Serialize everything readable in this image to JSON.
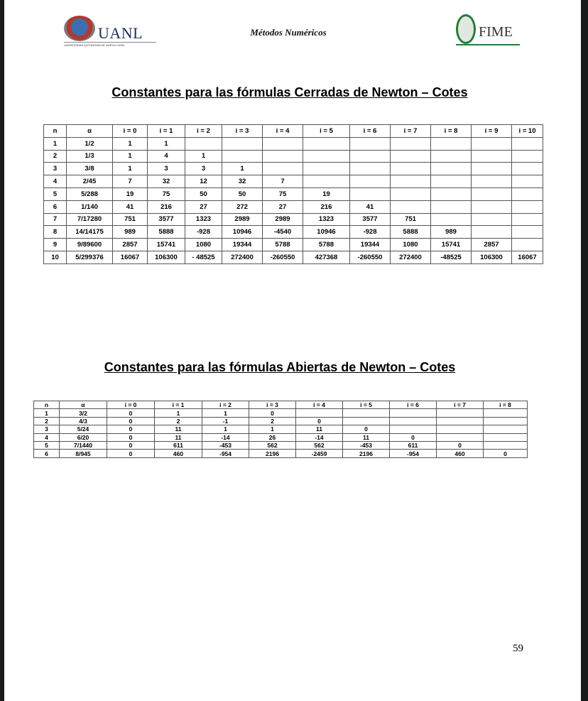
{
  "header": {
    "left_logo": {
      "word": "UANL",
      "subtitle": "UNIVERSIDAD AUTÓNOMA DE NUEVO LEÓN"
    },
    "title": "Métodos Numéricos",
    "right_logo": {
      "word": "FIME"
    }
  },
  "table1": {
    "title": "Constantes para las fórmulas Cerradas de Newton – Cotes",
    "headers": [
      "n",
      "α",
      "i = 0",
      "i = 1",
      "i = 2",
      "i = 3",
      "i = 4",
      "i = 5",
      "i = 6",
      "i = 7",
      "i = 8",
      "i = 9",
      "i = 10"
    ],
    "rows": [
      [
        "1",
        "1/2",
        "1",
        "1",
        "",
        "",
        "",
        "",
        "",
        "",
        "",
        "",
        ""
      ],
      [
        "2",
        "1/3",
        "1",
        "4",
        "1",
        "",
        "",
        "",
        "",
        "",
        "",
        "",
        ""
      ],
      [
        "3",
        "3/8",
        "1",
        "3",
        "3",
        "1",
        "",
        "",
        "",
        "",
        "",
        "",
        ""
      ],
      [
        "4",
        "2/45",
        "7",
        "32",
        "12",
        "32",
        "7",
        "",
        "",
        "",
        "",
        "",
        ""
      ],
      [
        "5",
        "5/288",
        "19",
        "75",
        "50",
        "50",
        "75",
        "19",
        "",
        "",
        "",
        "",
        ""
      ],
      [
        "6",
        "1/140",
        "41",
        "216",
        "27",
        "272",
        "27",
        "216",
        "41",
        "",
        "",
        "",
        ""
      ],
      [
        "7",
        "7/17280",
        "751",
        "3577",
        "1323",
        "2989",
        "2989",
        "1323",
        "3577",
        "751",
        "",
        "",
        ""
      ],
      [
        "8",
        "14/14175",
        "989",
        "5888",
        "-928",
        "10946",
        "-4540",
        "10946",
        "-928",
        "5888",
        "989",
        "",
        ""
      ],
      [
        "9",
        "9/89600",
        "2857",
        "15741",
        "1080",
        "19344",
        "5788",
        "5788",
        "19344",
        "1080",
        "15741",
        "2857",
        ""
      ],
      [
        "10",
        "5/299376",
        "16067",
        "106300",
        "- 48525",
        "272400",
        "-260550",
        "427368",
        "-260550",
        "272400",
        "-48525",
        "106300",
        "16067"
      ]
    ]
  },
  "table2": {
    "title": "Constantes para las fórmulas Abiertas de Newton – Cotes",
    "headers": [
      "n",
      "α",
      "i = 0",
      "i = 1",
      "i = 2",
      "i = 3",
      "i = 4",
      "i = 5",
      "i = 6",
      "i = 7",
      "i = 8"
    ],
    "rows": [
      [
        "1",
        "3/2",
        "0",
        "1",
        "1",
        "0",
        "",
        "",
        "",
        "",
        ""
      ],
      [
        "2",
        "4/3",
        "0",
        "2",
        "-1",
        "2",
        "0",
        "",
        "",
        "",
        ""
      ],
      [
        "3",
        "5/24",
        "0",
        "11",
        "1",
        "1",
        "11",
        "0",
        "",
        "",
        ""
      ],
      [
        "4",
        "6/20",
        "0",
        "11",
        "-14",
        "26",
        "-14",
        "11",
        "0",
        "",
        ""
      ],
      [
        "5",
        "7/1440",
        "0",
        "611",
        "-453",
        "562",
        "562",
        "-453",
        "611",
        "0",
        ""
      ],
      [
        "6",
        "8/945",
        "0",
        "460",
        "-954",
        "2196",
        "-2459",
        "2196",
        "-954",
        "460",
        "0"
      ]
    ]
  },
  "page_number": "59"
}
